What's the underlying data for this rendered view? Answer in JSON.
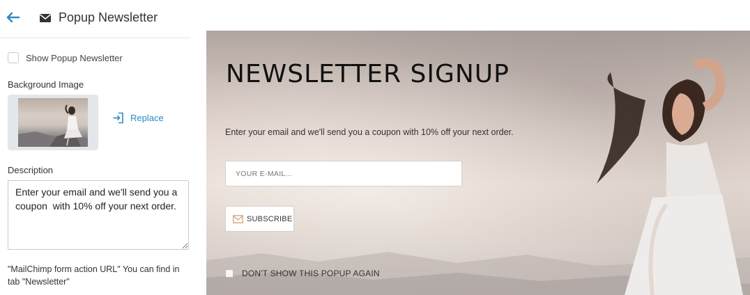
{
  "header": {
    "title": "Popup Newsletter",
    "back_icon": "arrow-left-icon",
    "title_icon": "envelope-icon"
  },
  "settings": {
    "show_popup_label": "Show Popup Newsletter",
    "show_popup_checked": false,
    "background_image_label": "Background Image",
    "replace_label": "Replace",
    "description_label": "Description",
    "description_value": "Enter your email and we'll send you a coupon  with 10% off your next order.",
    "note": "\"MailChimp form action URL\" You can find in tab \"Newsletter\""
  },
  "preview": {
    "title": "NEWSLETTER SIGNUP",
    "description": "Enter your email and we'll send you a coupon with 10% off your next order.",
    "email_placeholder": "YOUR E-MAIL...",
    "subscribe_label": "SUBSCRIBE",
    "dont_show_label": "DON'T SHOW THIS POPUP AGAIN"
  },
  "colors": {
    "accent": "#2d8ac4",
    "text": "#333333",
    "border": "#c9c9c9"
  }
}
